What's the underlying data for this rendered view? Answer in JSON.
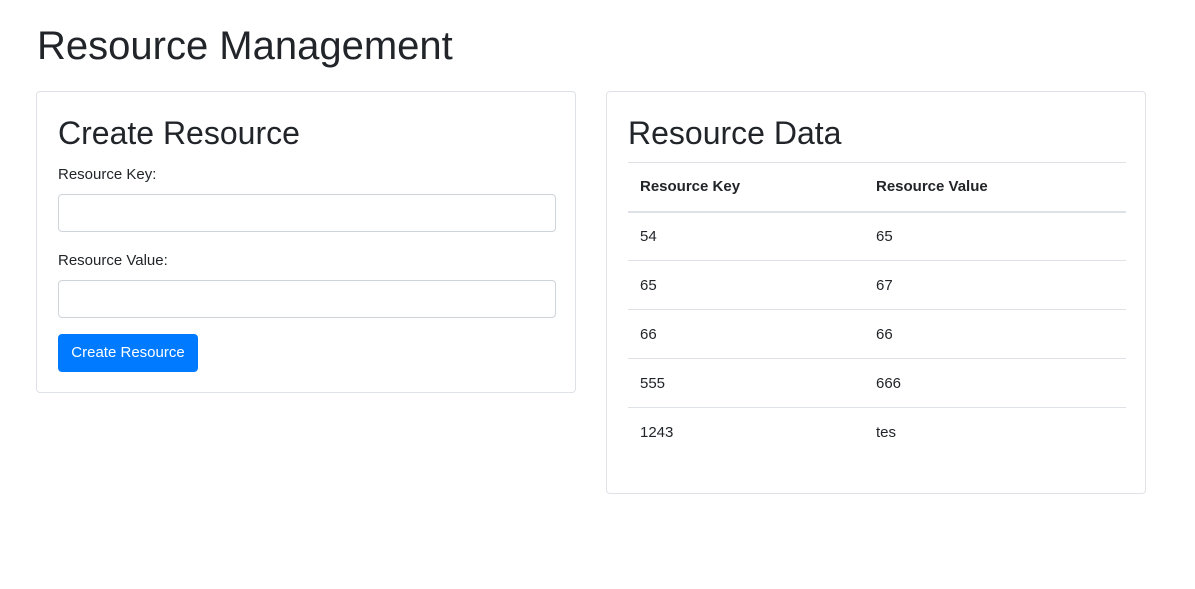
{
  "page": {
    "title": "Resource Management"
  },
  "create_form": {
    "title": "Create Resource",
    "key_label": "Resource Key:",
    "key_value": "",
    "value_label": "Resource Value:",
    "value_value": "",
    "submit_label": "Create Resource"
  },
  "resource_table": {
    "title": "Resource Data",
    "columns": [
      "Resource Key",
      "Resource Value"
    ],
    "rows": [
      {
        "key": "54",
        "value": "65"
      },
      {
        "key": "65",
        "value": "67"
      },
      {
        "key": "66",
        "value": "66"
      },
      {
        "key": "555",
        "value": "666"
      },
      {
        "key": "1243",
        "value": "tes"
      }
    ]
  },
  "colors": {
    "primary": "#007bff",
    "border": "#dee2e6",
    "text": "#212529"
  }
}
